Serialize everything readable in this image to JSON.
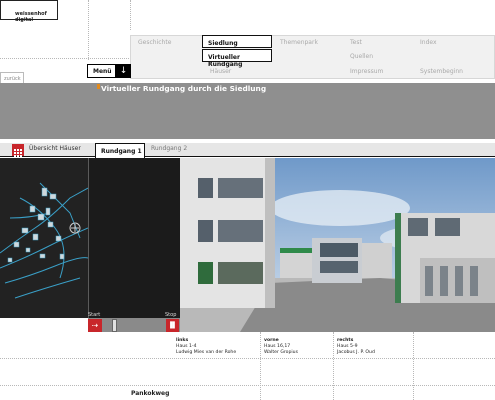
{
  "logo": {
    "text": "weissenhof digital"
  },
  "nav": {
    "row1": [
      "Geschichte",
      "Siedlung",
      "Themenpark",
      "Test",
      "Index"
    ],
    "row2": [
      "",
      "Virtueller Rundgang",
      "",
      "Quellen",
      ""
    ],
    "row3": [
      "",
      "Häuser",
      "",
      "Impressum",
      "Systembeginn"
    ]
  },
  "back_label": "zurück",
  "menu": {
    "label": "Menü"
  },
  "page_title": "Virtueller Rundgang durch die Siedlung",
  "tabs": {
    "overview": "Übersicht Häuser",
    "items": [
      "Rundgang 1",
      "Rundgang 2"
    ]
  },
  "player": {
    "start_label": "Start",
    "stop_label": "Stop",
    "progress": 0.15
  },
  "info": {
    "left": {
      "title": "links",
      "house": "Haus 1-4",
      "architect": "Ludwig Mies van der Rohe"
    },
    "front": {
      "title": "vorne",
      "house": "Haus 16,17",
      "architect": "Walter Gropius"
    },
    "right": {
      "title": "rechts",
      "house": "Haus 5-9",
      "architect": "Jacobus J. P. Oud"
    }
  },
  "street": "Pankokweg",
  "colors": {
    "accent_red": "#c8262b",
    "accent_orange": "#e38a1b",
    "band_gray": "#8f8f8f"
  },
  "icons": [
    "grid-icon",
    "menu-arrow-icon",
    "play-icon",
    "stop-icon"
  ]
}
